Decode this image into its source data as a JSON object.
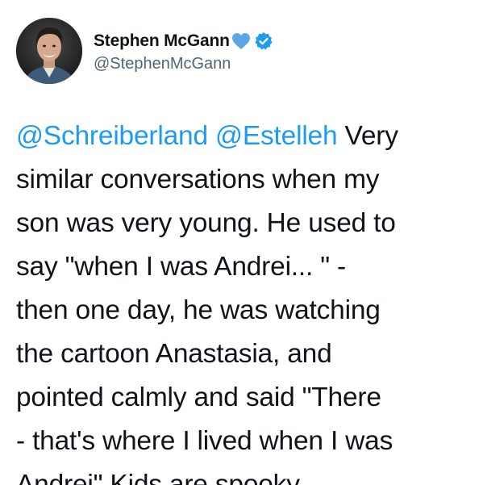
{
  "tweet": {
    "author": {
      "display_name": "Stephen McGann",
      "handle": "@StephenMcGann",
      "avatar_icon": "profile-photo",
      "heart_icon": "blue-heart-icon",
      "verified_icon": "verified-badge-icon"
    },
    "mentions": [
      "@Schreiberland",
      "@Estelleh"
    ],
    "lines": [
      " Very",
      "similar conversations when my",
      "son was very young. He used to",
      "say \"when I was Andrei... \" -",
      "then one day, he was watching",
      "the cartoon Anastasia, and",
      "pointed calmly and said  \"There",
      "- that's where I lived when I was",
      "Andrei\"  Kids are spooky..."
    ]
  },
  "colors": {
    "link": "#1d9bf0",
    "text": "#0f1419",
    "muted": "#536471"
  }
}
